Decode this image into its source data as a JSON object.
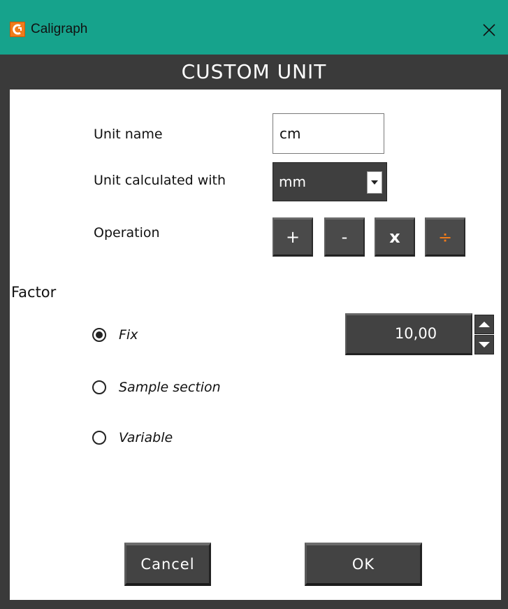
{
  "window": {
    "title": "Caligraph",
    "app_icon": "caligraph-logo-icon",
    "close_icon": "close-icon",
    "accent_color": "#16a38c",
    "dark_color": "#3a3a3a",
    "highlight_color": "#f07b1a"
  },
  "dialog": {
    "header": "CUSTOM UNIT"
  },
  "form": {
    "unit_name_label": "Unit name",
    "unit_name_value": "cm",
    "calc_label": "Unit calculated with",
    "calc_value": "mm",
    "operation_label": "Operation",
    "operations": [
      "+",
      "-",
      "x",
      "÷"
    ],
    "selected_operation": "÷"
  },
  "factor": {
    "label": "Factor",
    "options": [
      "Fix",
      "Sample section",
      "Variable"
    ],
    "selected": "Fix",
    "value": "10,00"
  },
  "buttons": {
    "cancel": "Cancel",
    "ok": "OK"
  }
}
